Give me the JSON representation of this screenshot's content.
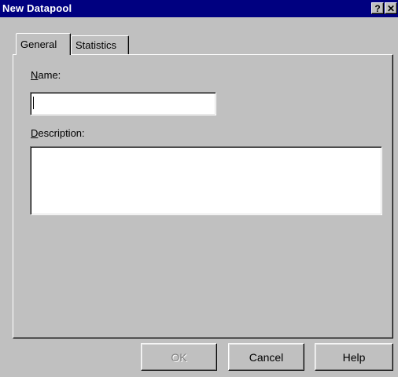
{
  "window": {
    "title": "New Datapool",
    "help_glyph": "?",
    "close_glyph": "✕"
  },
  "tabs": [
    {
      "label": "General",
      "selected": true
    },
    {
      "label": "Statistics",
      "selected": false
    }
  ],
  "general": {
    "name_label_mnemonic": "N",
    "name_label_rest": "ame:",
    "name_value": "",
    "description_label_mnemonic": "D",
    "description_label_rest": "escription:",
    "description_value": ""
  },
  "buttons": {
    "ok": "OK",
    "ok_enabled": false,
    "cancel": "Cancel",
    "help": "Help"
  },
  "colors": {
    "titlebar": "#000080",
    "face": "#c0c0c0"
  }
}
